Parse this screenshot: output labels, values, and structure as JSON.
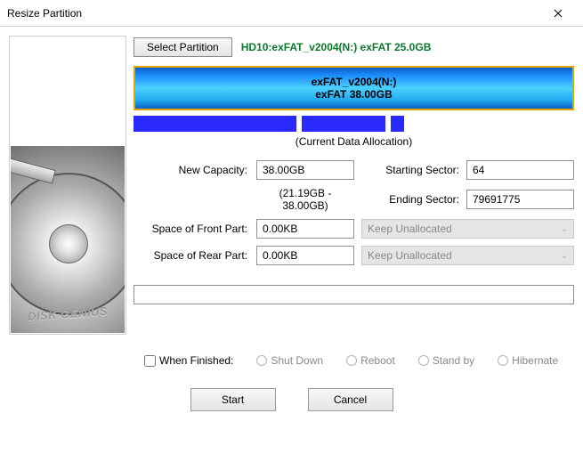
{
  "window": {
    "title": "Resize Partition"
  },
  "top": {
    "select_btn": "Select Partition",
    "path": "HD10:exFAT_v2004(N:) exFAT 25.0GB"
  },
  "partition": {
    "name": "exFAT_v2004(N:)",
    "subtitle": "exFAT 38.00GB"
  },
  "alloc_label": "(Current Data Allocation)",
  "labels": {
    "new_capacity": "New Capacity:",
    "range_hint": "(21.19GB - 38.00GB)",
    "starting_sector": "Starting Sector:",
    "ending_sector": "Ending Sector:",
    "space_front": "Space of Front Part:",
    "space_rear": "Space of Rear Part:"
  },
  "values": {
    "new_capacity": "38.00GB",
    "starting_sector": "64",
    "ending_sector": "79691775",
    "space_front": "0.00KB",
    "space_rear": "0.00KB",
    "front_action": "Keep Unallocated",
    "rear_action": "Keep Unallocated"
  },
  "finish": {
    "label": "When Finished:",
    "options": [
      "Shut Down",
      "Reboot",
      "Stand by",
      "Hibernate"
    ]
  },
  "buttons": {
    "start": "Start",
    "cancel": "Cancel"
  },
  "brand": "DISK GENIUS"
}
